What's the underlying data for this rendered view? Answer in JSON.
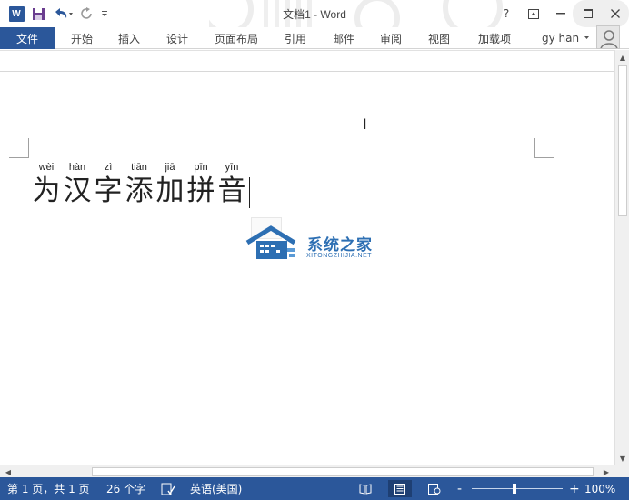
{
  "window": {
    "title": "文档1 - Word",
    "app_logo": "W",
    "controls": {
      "help": "?",
      "ribbon_display": "⊡",
      "minimize": "—",
      "maximize": "☐",
      "close": "✕"
    }
  },
  "qat": {
    "save": "save-icon",
    "undo": "undo-icon",
    "redo": "redo-icon",
    "customize": "customize-icon"
  },
  "ribbon": {
    "file": "文件",
    "tabs": [
      "开始",
      "插入",
      "设计",
      "页面布局",
      "引用",
      "邮件",
      "审阅",
      "视图",
      "加载项"
    ],
    "user": "gy han"
  },
  "document": {
    "ruby": [
      {
        "pinyin": "wèi",
        "char": "为"
      },
      {
        "pinyin": "hàn",
        "char": "汉"
      },
      {
        "pinyin": "zì",
        "char": "字"
      },
      {
        "pinyin": "tiān",
        "char": "添"
      },
      {
        "pinyin": "jiā",
        "char": "加"
      },
      {
        "pinyin": "pīn",
        "char": "拼"
      },
      {
        "pinyin": "yīn",
        "char": "音"
      }
    ]
  },
  "watermark": {
    "name": "系统之家",
    "url": "XITONGZHIJIA.NET"
  },
  "status": {
    "page": "第 1 页，共 1 页",
    "words": "26 个字",
    "language": "英语(美国)",
    "zoom_minus": "-",
    "zoom_plus": "+",
    "zoom": "100%",
    "zoom_level": 100
  },
  "colors": {
    "accent": "#2b579a",
    "watermark": "#2d6fb3"
  }
}
